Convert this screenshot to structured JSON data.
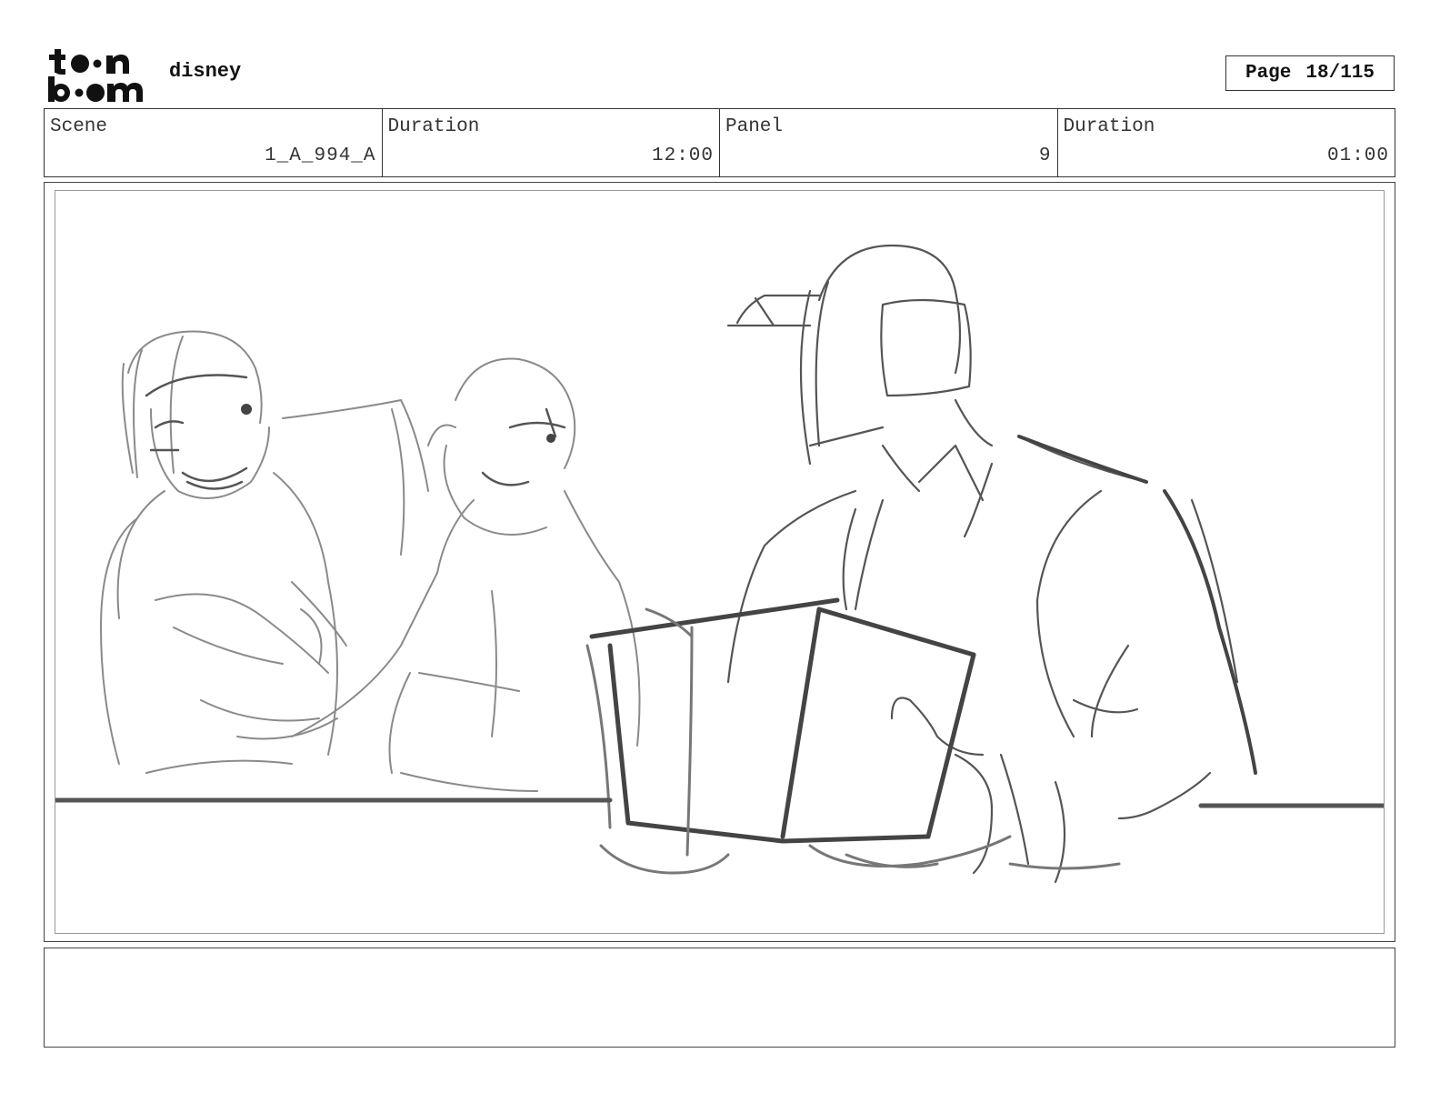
{
  "header": {
    "logo_text": "toon boom",
    "studio": "disney",
    "page_label": "Page",
    "page_value": "18/115"
  },
  "info": {
    "scene_label": "Scene",
    "scene_value": "1_A_994_A",
    "duration_label": "Duration",
    "duration_value": "12:00",
    "panel_label": "Panel",
    "panel_value": "9",
    "panel_duration_label": "Duration",
    "panel_duration_value": "01:00"
  },
  "panel": {
    "drawing": "rough pencil storyboard sketch"
  },
  "notes": {
    "text": ""
  },
  "colors": {
    "ink_dark": "#444444",
    "ink_light": "#8a8a8a",
    "border": "#333333"
  }
}
